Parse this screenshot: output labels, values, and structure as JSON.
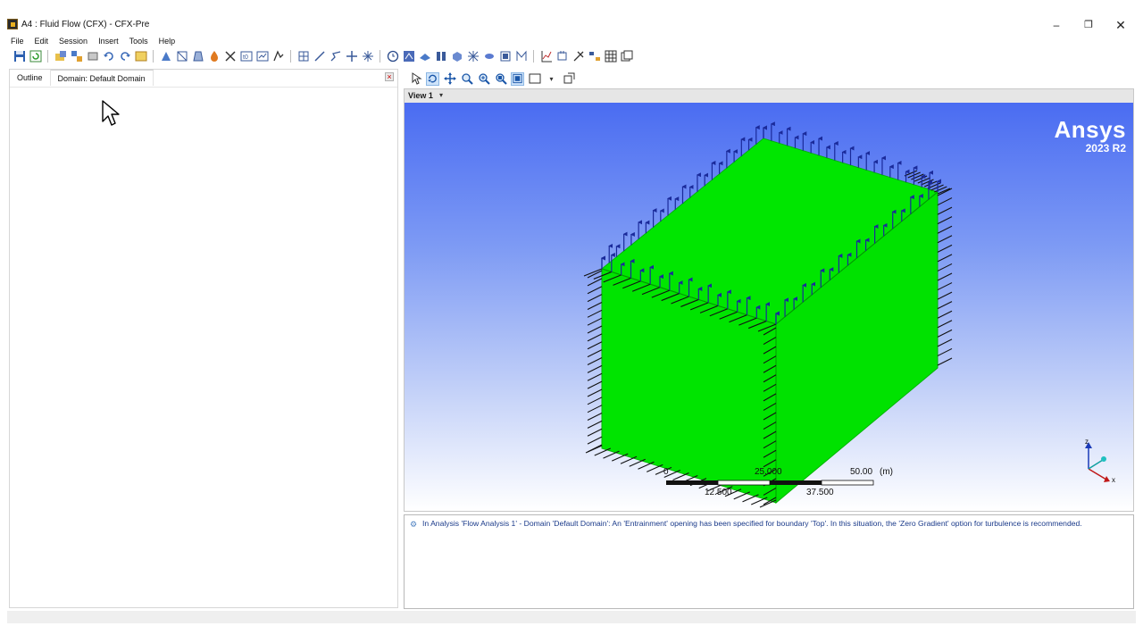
{
  "window": {
    "title": "A4 : Fluid Flow (CFX) - CFX-Pre",
    "minimize_glyph": "–",
    "maximize_glyph": "❐",
    "close_glyph": "✕"
  },
  "menu": [
    "File",
    "Edit",
    "Session",
    "Insert",
    "Tools",
    "Help"
  ],
  "left_panel": {
    "tabs": [
      "Outline",
      "Domain: Default Domain"
    ],
    "active_tab": "Domain: Default Domain"
  },
  "viewer": {
    "viewport_label": "View 1",
    "caret": "▾",
    "brand_name": "Ansys",
    "brand_version": "2023 R2",
    "scale_labels": [
      "0",
      "12.500",
      "25.000",
      "37.500",
      "50.00"
    ],
    "scale_units": "(m)",
    "axis_labels": {
      "z": "z",
      "x": "x"
    }
  },
  "colors": {
    "domain_fill": "#00e600",
    "domain_edge": "#00b400",
    "opening_arrow": "#1a2a9a",
    "wall_arrow": "#111111",
    "viewport_top": "#4a6cf2",
    "viewport_bottom": "#ffffff",
    "message_text": "#1a3a8a"
  },
  "messages": [
    "In Analysis 'Flow Analysis 1' - Domain 'Default Domain': An 'Entrainment' opening has been specified for boundary 'Top'. In this situation, the 'Zero Gradient' option for turbulence is recommended."
  ]
}
